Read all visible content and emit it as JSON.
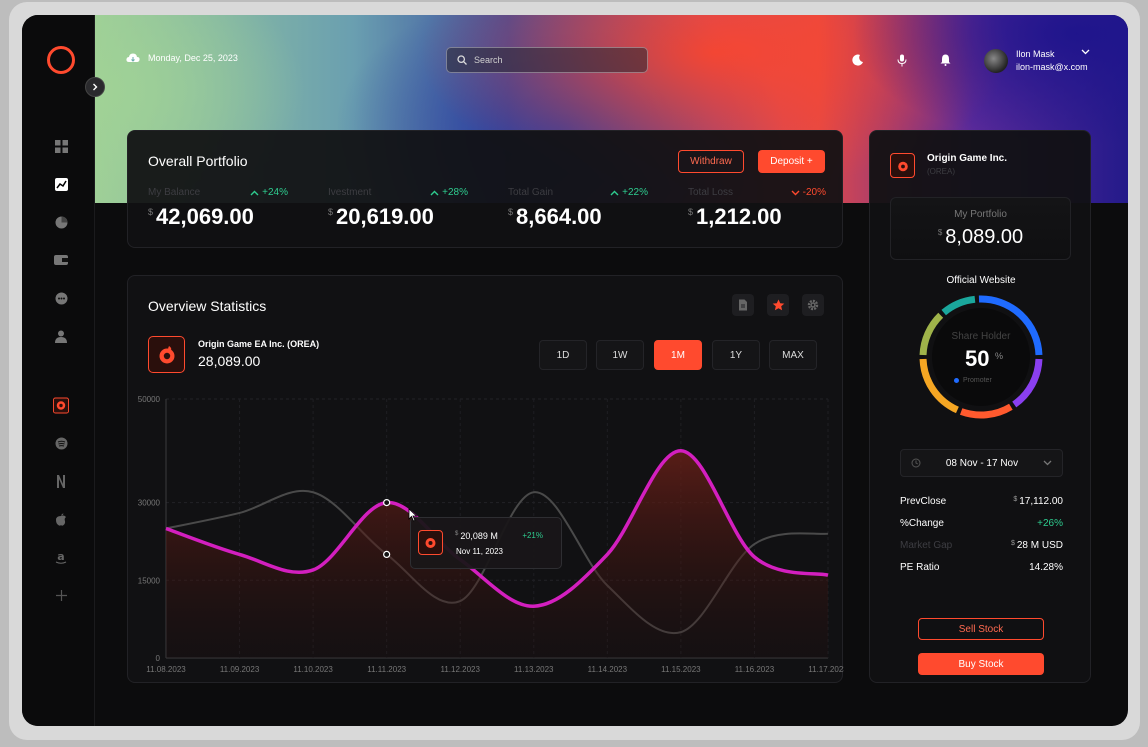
{
  "topbar": {
    "date": "Monday, Dec 25, 2023",
    "search_placeholder": "Search",
    "user_name": "Ilon Mask",
    "user_email": "ilon-mask@x.com"
  },
  "sidebar": {
    "items": [
      "dashboard-icon",
      "trending-chart-icon",
      "pie-chart-icon",
      "wallet-icon",
      "chat-icon",
      "user-icon"
    ],
    "apps": [
      "origin-icon",
      "spotify-icon",
      "netflix-icon",
      "apple-icon",
      "amazon-icon",
      "plus-icon"
    ]
  },
  "portfolio": {
    "title": "Overall Portfolio",
    "withdraw_label": "Withdraw",
    "deposit_label": "Deposit +",
    "currency": "$",
    "metrics": [
      {
        "label": "My Balance",
        "change": "+24%",
        "value": "42,069.00",
        "trend": "up"
      },
      {
        "label": "Ivestment",
        "change": "+28%",
        "value": "20,619.00",
        "trend": "up"
      },
      {
        "label": "Total Gain",
        "change": "+22%",
        "value": "8,664.00",
        "trend": "up"
      },
      {
        "label": "Total Loss",
        "change": "-20%",
        "value": "1,212.00",
        "trend": "down"
      }
    ]
  },
  "stats": {
    "title": "Overview Statistics",
    "company_name": "Origin Game EA Inc. (OREA)",
    "company_value": "28,089.00",
    "ranges": [
      "1D",
      "1W",
      "1M",
      "1Y",
      "MAX"
    ],
    "active_range": "1M",
    "tooltip": {
      "value": "20,089 M",
      "change": "+21%",
      "date": "Nov 11, 2023"
    }
  },
  "chart_data": {
    "type": "area",
    "x": [
      "11.08.2023",
      "11.09.2023",
      "11.10.2023",
      "11.11.2023",
      "11.12.2023",
      "11.13.2023",
      "11.14.2023",
      "11.15.2023",
      "11.16.2023",
      "11.17.2023"
    ],
    "yticks": [
      "50000",
      "30000",
      "15000",
      "0"
    ],
    "ylim": [
      0,
      50000
    ],
    "series": [
      {
        "values": [
          25000,
          20000,
          17000,
          30000,
          19000,
          10000,
          20000,
          40000,
          19500,
          16000
        ],
        "color": "#d31fbf",
        "filled": true
      },
      {
        "values": [
          25000,
          28000,
          32000,
          20000,
          11000,
          32000,
          14000,
          5000,
          22000,
          24000
        ],
        "color": "#4a4a4a",
        "filled": false
      }
    ],
    "grid": true
  },
  "company": {
    "name": "Origin Game Inc.",
    "ticker": "(OREA)",
    "portfolio_label": "My Portfolio",
    "portfolio_value": "8,089.00",
    "website_label": "Official Website",
    "share_label": "Share Holder",
    "share_value": "50",
    "share_unit": "%",
    "promoter_label": "Promoter",
    "date_range": "08 Nov - 17 Nov",
    "details": [
      {
        "label": "PrevClose",
        "currency": "$",
        "value": "17,112.00"
      },
      {
        "label": "%Change",
        "currency": "",
        "value": "+26%"
      },
      {
        "label": "Market Gap",
        "currency": "$",
        "value": "28 M USD"
      },
      {
        "label": "PE Ratio",
        "currency": "",
        "value": "14.28%"
      }
    ],
    "sell_label": "Sell Stock",
    "buy_label": "Buy Stock"
  },
  "colors": {
    "accent": "#ff4a2e",
    "positive": "#2ecc8f",
    "negative": "#ff4a2e",
    "line_primary": "#d31fbf"
  }
}
